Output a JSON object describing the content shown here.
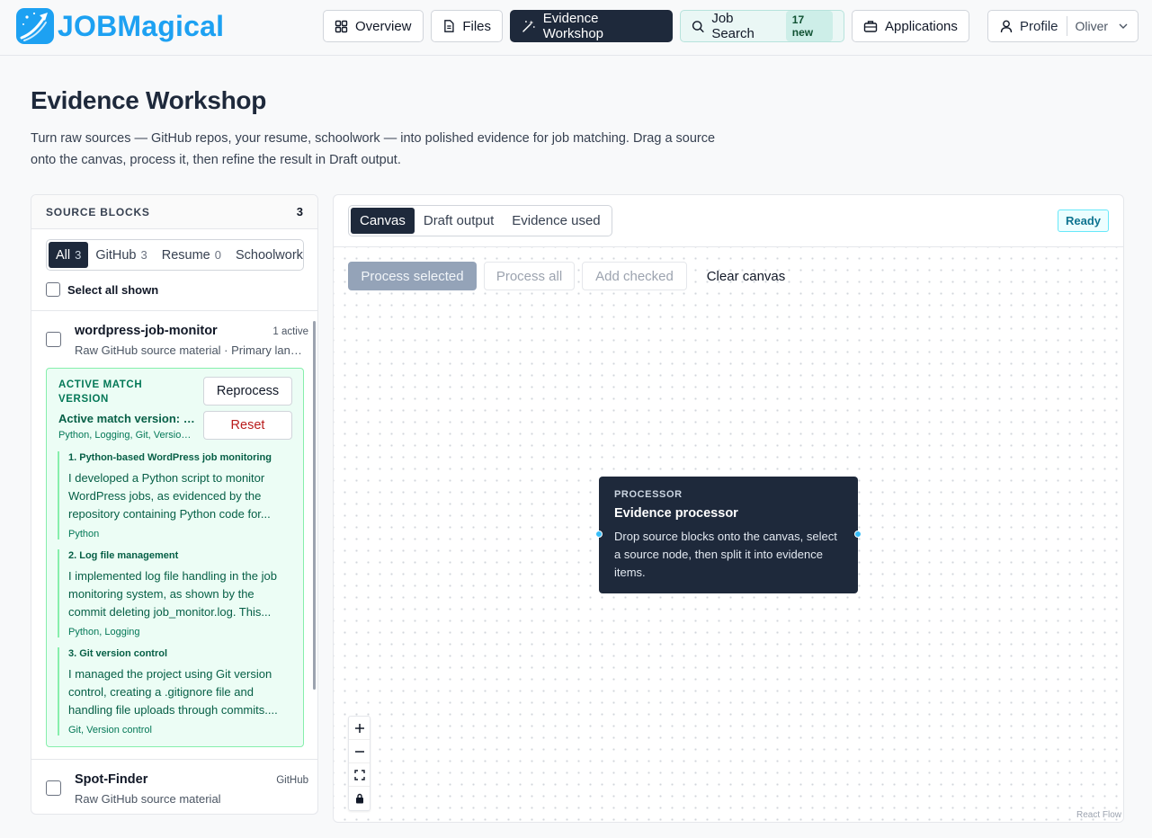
{
  "brand": {
    "job": "JOB",
    "magical": "Magical"
  },
  "nav": {
    "overview": "Overview",
    "files": "Files",
    "evidence_workshop": "Evidence Workshop",
    "job_search": "Job Search",
    "job_search_badge": "17 new",
    "applications": "Applications"
  },
  "profile": {
    "label": "Profile",
    "user": "Oliver"
  },
  "page": {
    "title": "Evidence Workshop",
    "description": "Turn raw sources — GitHub repos, your resume, schoolwork — into polished evidence for job matching. Drag a source onto the canvas, process it, then refine the result in Draft output."
  },
  "source_blocks": {
    "title": "SOURCE BLOCKS",
    "count": "3",
    "filters": [
      {
        "label": "All",
        "count": "3"
      },
      {
        "label": "GitHub",
        "count": "3"
      },
      {
        "label": "Resume",
        "count": "0"
      },
      {
        "label": "Schoolwork",
        "count": ""
      }
    ],
    "select_all": "Select all shown",
    "items": [
      {
        "name": "wordpress-job-monitor",
        "tag": "1 active",
        "subtitle": "Raw GitHub source material · Primary language: Python"
      },
      {
        "name": "Spot-Finder",
        "tag": "GitHub",
        "subtitle": "Raw GitHub source material"
      }
    ],
    "active_match": {
      "label": "ACTIVE MATCH VERSION",
      "title": "Active match version: wordpress-job-monitor",
      "tags": "Python, Logging, Git, Version control",
      "reprocess": "Reprocess",
      "reset": "Reset",
      "evidence": [
        {
          "title": "1. Python-based WordPress job monitoring",
          "body": "I developed a Python script to monitor WordPress jobs, as evidenced by the repository containing Python code for...",
          "tags": "Python"
        },
        {
          "title": "2. Log file management",
          "body": "I implemented log file handling in the job monitoring system, as shown by the commit deleting job_monitor.log. This...",
          "tags": "Python, Logging"
        },
        {
          "title": "3. Git version control",
          "body": "I managed the project using Git version control, creating a .gitignore file and handling file uploads through commits....",
          "tags": "Git, Version control"
        }
      ]
    }
  },
  "workspace": {
    "tabs": [
      "Canvas",
      "Draft output",
      "Evidence used"
    ],
    "status": "Ready",
    "toolbar": {
      "process_selected": "Process selected",
      "process_all": "Process all",
      "add_checked": "Add checked",
      "clear_canvas": "Clear canvas"
    },
    "processor": {
      "label": "PROCESSOR",
      "title": "Evidence processor",
      "description": "Drop source blocks onto the canvas, select a source node, then split it into evidence items."
    },
    "attribution": "React Flow"
  },
  "colors": {
    "brand": "#1da1f2",
    "dark": "#1e293b",
    "success_bg": "#ecfdf5",
    "success_text": "#065f46",
    "ready": "#0e7490"
  }
}
